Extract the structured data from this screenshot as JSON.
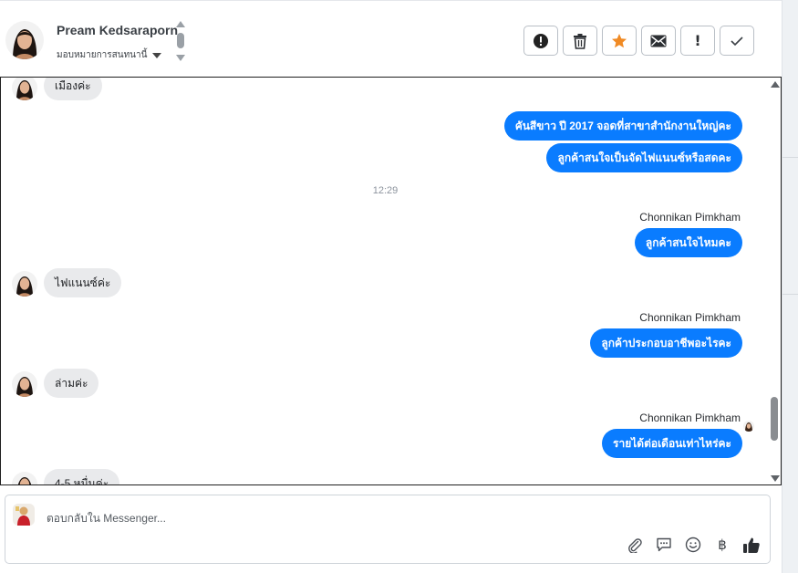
{
  "header": {
    "name": "Pream Kedsaraporn",
    "assign_label": "มอบหมายการสนทนานี้"
  },
  "actions": [
    {
      "icon": "alert-circle-icon",
      "label": "!"
    },
    {
      "icon": "trash-icon"
    },
    {
      "icon": "star-icon",
      "color": "#f08a24"
    },
    {
      "icon": "envelope-icon"
    },
    {
      "icon": "exclamation-icon",
      "label": "!"
    },
    {
      "icon": "check-icon"
    }
  ],
  "messages": [
    {
      "dir": "in",
      "text": "เมืองค่ะ"
    },
    {
      "dir": "out",
      "text": "คันสีขาว ปี 2017 จอดที่สาขาสำนักงานใหญ่คะ"
    },
    {
      "dir": "out",
      "text": "ลูกค้าสนใจเป็นจัดไฟแนนซ์หรือสดคะ"
    },
    {
      "time": "12:29"
    },
    {
      "dir": "out",
      "sender": "Chonnikan Pimkham",
      "text": "ลูกค้าสนใจไหมคะ"
    },
    {
      "dir": "in",
      "text": "ไฟแนนซ์ค่ะ"
    },
    {
      "dir": "out",
      "sender": "Chonnikan Pimkham",
      "text": "ลูกค้าประกอบอาชีพอะไรคะ"
    },
    {
      "dir": "in",
      "text": "ล่ามค่ะ"
    },
    {
      "dir": "out",
      "sender": "Chonnikan Pimkham",
      "text": "รายได้ต่อเดือนเท่าไหร่คะ"
    },
    {
      "dir": "in",
      "text": "4-5 หมื่นค่ะ"
    }
  ],
  "composer": {
    "placeholder": "ตอบกลับใน Messenger...",
    "tools": [
      "paperclip-icon",
      "chat-bubble-icon",
      "smiley-icon",
      "baht-icon",
      "thumbs-up-icon"
    ],
    "baht_label": "฿"
  },
  "colors": {
    "outgoing_bubble": "#0a7cff",
    "incoming_bubble": "#e9eaec",
    "star": "#f08a24"
  }
}
